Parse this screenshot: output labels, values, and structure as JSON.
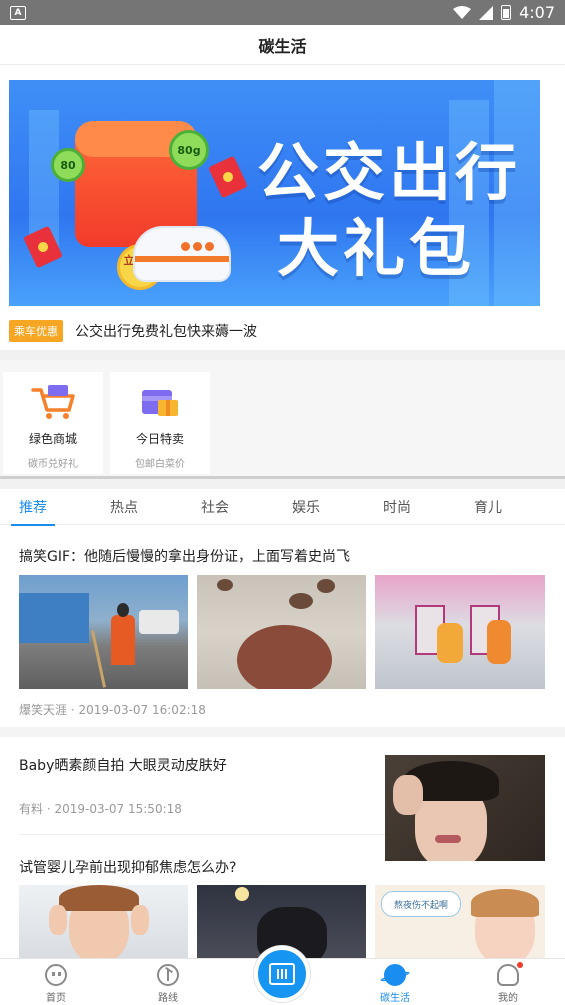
{
  "status_bar": {
    "time": "4:07",
    "app_icon_letter": "A"
  },
  "header": {
    "title": "碳生活"
  },
  "banner": {
    "headline_line1": "公交出行",
    "headline_line2": "大礼包",
    "coin_text": "立即领取",
    "bubble_values": [
      "80g",
      "80"
    ]
  },
  "promo": {
    "tag": "乘车优惠",
    "text": "公交出行免费礼包快来薅一波"
  },
  "shortcuts": [
    {
      "title": "绿色商城",
      "subtitle": "碳币兑好礼",
      "icon": "shopping-cart-icon"
    },
    {
      "title": "今日特卖",
      "subtitle": "包邮白菜价",
      "icon": "gift-card-icon"
    }
  ],
  "tabs": [
    "推荐",
    "热点",
    "社会",
    "娱乐",
    "时尚",
    "育儿"
  ],
  "active_tab": "推荐",
  "feed": [
    {
      "title": "搞笑GIF：他随后慢慢的拿出身份证，上面写着史尚飞",
      "source": "爆笑天涯",
      "time": "2019-03-07 16:02:18",
      "meta": "爆笑天涯 · 2019-03-07 16:02:18"
    },
    {
      "title": "Baby晒素颜自拍 大眼灵动皮肤好",
      "source": "有料",
      "time": "2019-03-07 15:50:18",
      "meta": "有料 · 2019-03-07 15:50:18"
    },
    {
      "title": "试管婴儿孕前出现抑郁焦虑怎么办?",
      "thumb_caption": "熬夜伤不起啊"
    }
  ],
  "bottom_nav": [
    {
      "label": "首页",
      "icon": "home-face-icon"
    },
    {
      "label": "路线",
      "icon": "route-icon"
    },
    {
      "label": "",
      "icon": "scan-icon"
    },
    {
      "label": "碳生活",
      "icon": "planet-icon",
      "active": true
    },
    {
      "label": "我的",
      "icon": "user-icon"
    }
  ],
  "colors": {
    "accent": "#1a8df0",
    "promo_tag": "#f6a623",
    "banner_blue": "#2f76f0"
  }
}
